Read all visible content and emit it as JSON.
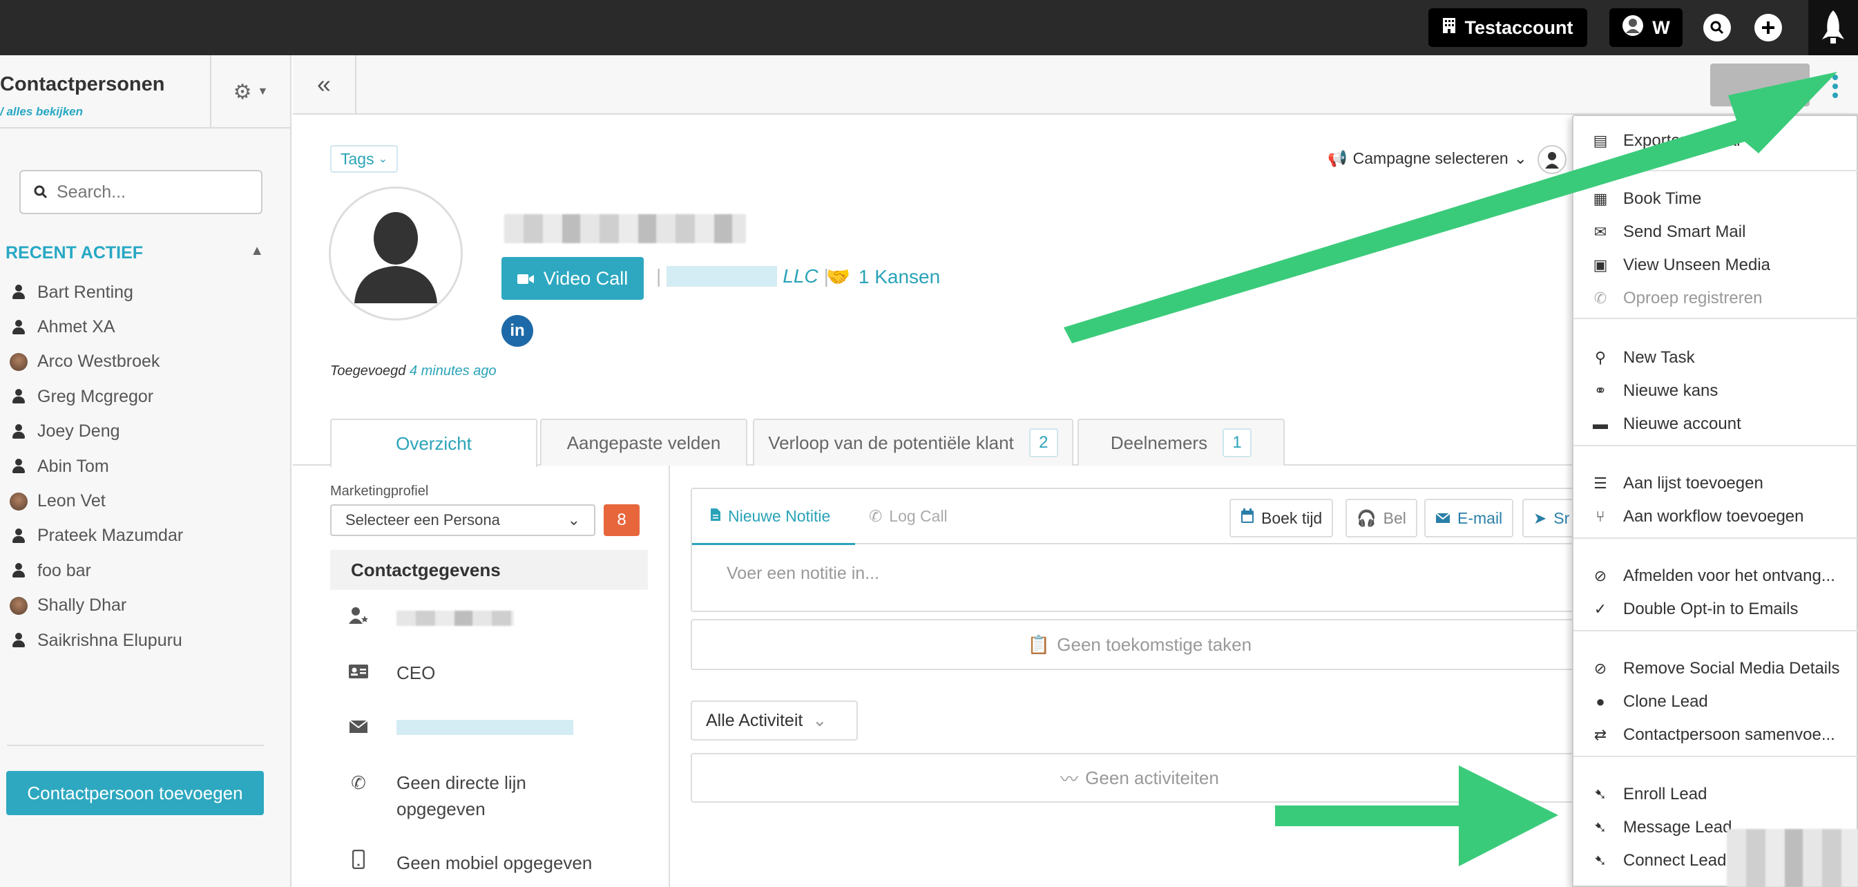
{
  "topbar": {
    "account_label": "Testaccount",
    "user_initial": "W"
  },
  "sidebar": {
    "title": "Contactpersonen",
    "view_all": "/ alles bekijken",
    "search_placeholder": "Search...",
    "recent_heading": "RECENT ACTIEF",
    "contacts": [
      {
        "name": "Bart Renting",
        "avatar": "person-icon"
      },
      {
        "name": "Ahmet XA",
        "avatar": "person-icon"
      },
      {
        "name": "Arco Westbroek",
        "avatar": "photo"
      },
      {
        "name": "Greg Mcgregor",
        "avatar": "person-icon"
      },
      {
        "name": "Joey Deng",
        "avatar": "person-icon"
      },
      {
        "name": "Abin Tom",
        "avatar": "person-icon"
      },
      {
        "name": "Leon Vet",
        "avatar": "photo"
      },
      {
        "name": "Prateek Mazumdar",
        "avatar": "person-icon"
      },
      {
        "name": "foo bar",
        "avatar": "person-icon"
      },
      {
        "name": "Shally Dhar",
        "avatar": "photo"
      },
      {
        "name": "Saikrishna Elupuru",
        "avatar": "person-icon"
      }
    ],
    "add_button": "Contactpersoon toevoegen"
  },
  "profile": {
    "tags_label": "Tags",
    "campaign_label": "Campagne selecteren",
    "video_call_label": "Video Call",
    "company_suffix": "LLC",
    "opportunities_label": "1 Kansen",
    "linkedin_label": "in",
    "added_prefix": "Toegevoegd",
    "added_time": "4 minutes ago"
  },
  "tabs": [
    {
      "label": "Overzicht",
      "badge": ""
    },
    {
      "label": "Aangepaste velden",
      "badge": ""
    },
    {
      "label": "Verloop van de potentiële klant",
      "badge": "2"
    },
    {
      "label": "Deelnemers",
      "badge": "1"
    }
  ],
  "details": {
    "marketing_label": "Marketingprofiel",
    "persona_placeholder": "Selecteer een Persona",
    "persona_count": "8",
    "contact_heading": "Contactgegevens",
    "job_title": "CEO",
    "no_direct_line": "Geen directe lijn opgegeven",
    "no_mobile": "Geen mobiel opgegeven"
  },
  "activity": {
    "note_tab": "Nieuwe Notitie",
    "log_call_tab": "Log Call",
    "book_time_btn": "Boek tijd",
    "call_btn": "Bel",
    "email_btn": "E-mail",
    "sms_btn": "Sr",
    "note_placeholder": "Voer een notitie in...",
    "no_tasks": "Geen toekomstige taken",
    "filter_label": "Alle Activiteit",
    "no_activities": "Geen activiteiten"
  },
  "menu": {
    "export_label": "Exporteren naar",
    "items": [
      {
        "label": "Book Time",
        "icon": "calendar-icon"
      },
      {
        "label": "Send Smart Mail",
        "icon": "envelope-icon"
      },
      {
        "label": "View Unseen Media",
        "icon": "film-icon"
      },
      {
        "label": "Oproep registreren",
        "icon": "phone-icon"
      },
      {
        "label": "New Task",
        "icon": "pin-icon"
      },
      {
        "label": "Nieuwe kans",
        "icon": "handshake-icon"
      },
      {
        "label": "Nieuwe account",
        "icon": "briefcase-icon"
      },
      {
        "label": "Aan lijst toevoegen",
        "icon": "list-icon"
      },
      {
        "label": "Aan workflow toevoegen",
        "icon": "workflow-icon"
      },
      {
        "label": "Afmelden voor het ontvang...",
        "icon": "ban-icon"
      },
      {
        "label": "Double Opt-in to Emails",
        "icon": "check-icon"
      },
      {
        "label": "Remove Social Media Details",
        "icon": "ban-icon"
      },
      {
        "label": "Clone Lead",
        "icon": "user-icon"
      },
      {
        "label": "Contactpersoon samenvoe...",
        "icon": "swap-icon"
      },
      {
        "label": "Enroll Lead",
        "icon": "lead-icon"
      },
      {
        "label": "Message Lead",
        "icon": "lead-icon"
      },
      {
        "label": "Connect Lead",
        "icon": "lead-icon"
      }
    ]
  },
  "colors": {
    "accent": "#2da8c0",
    "arrow": "#3acb7a",
    "badge_orange": "#e8663c",
    "topbar": "#2a2a2a"
  }
}
